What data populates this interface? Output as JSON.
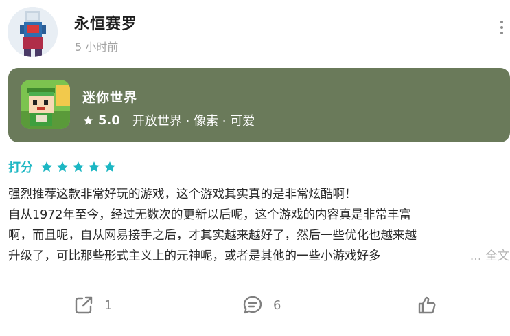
{
  "post": {
    "username": "永恒赛罗",
    "timestamp": "5 小时前"
  },
  "game": {
    "name": "迷你世界",
    "rating": "5.0",
    "tags": "开放世界 · 像素 · 可爱",
    "card_color": "#6a7a5a"
  },
  "score": {
    "label": "打分",
    "stars": 5,
    "max_stars": 5,
    "accent_color": "#1db7c3"
  },
  "review": {
    "lines": [
      "强烈推荐这款非常好玩的游戏，这个游戏其实真的是非常炫酷啊！",
      "自从1972年至今，经过无数次的更新以后呢，这个游戏的内容真是非常丰富",
      "啊，而且呢，自从网易接手之后，才其实越来越好了，然后一些优化也越来越",
      "升级了，可比那些形式主义上的元神呢，或者是其他的一些小游戏好多"
    ],
    "more_label": "... 全文"
  },
  "actions": {
    "share_count": "1",
    "comment_count": "6"
  }
}
